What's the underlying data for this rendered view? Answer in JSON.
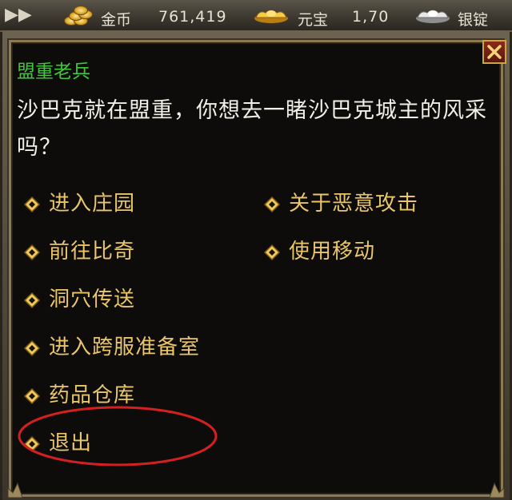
{
  "currency_bar": {
    "gold": {
      "label": "金币",
      "value": "761,419",
      "icon": "gold-coins-icon"
    },
    "yuanbao": {
      "label": "元宝",
      "value": "1,70",
      "icon": "gold-ingot-icon"
    },
    "silver": {
      "label": "银锭",
      "icon": "silver-ingot-icon"
    }
  },
  "dialog": {
    "npc_name": "盟重老兵",
    "text": "沙巴克就在盟重，你想去一睹沙巴克城主的风采吗？",
    "options_left": [
      "进入庄园",
      "前往比奇",
      "洞穴传送",
      "进入跨服准备室",
      "药品仓库",
      "退出"
    ],
    "options_right": [
      "关于恶意攻击",
      "使用移动"
    ],
    "highlighted_option": "药品仓库"
  },
  "colors": {
    "npc_name": "#3ec93a",
    "option_text": "#e9c66a",
    "dialog_text": "#f2efe6",
    "highlight_ring": "#d42020"
  }
}
